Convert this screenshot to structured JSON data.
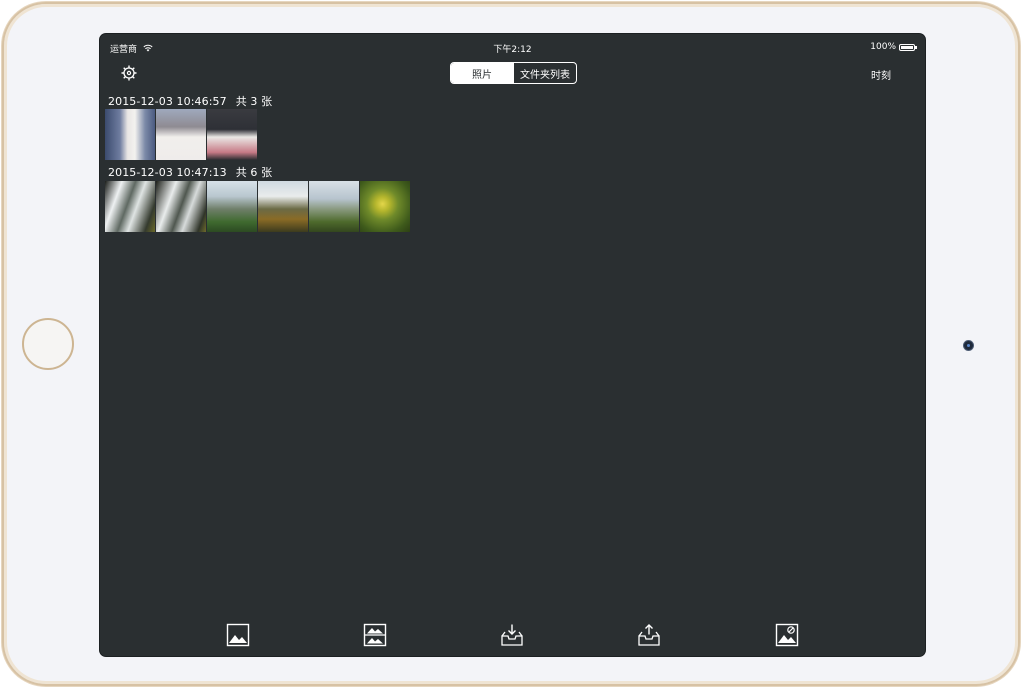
{
  "status_bar": {
    "carrier": "运营商",
    "time": "下午2:12",
    "battery": "100%"
  },
  "nav": {
    "segments": [
      "照片",
      "文件夹列表"
    ],
    "selected_segment": "照片",
    "right_button": "时刻",
    "left_icon": "settings-gear-icon"
  },
  "groups": [
    {
      "timestamp": "2015-12-03 10:46:57",
      "count_label": "共 3 张",
      "thumbnails": [
        "portrait-photo",
        "portrait-photo",
        "portrait-photo"
      ]
    },
    {
      "timestamp": "2015-12-03 10:47:13",
      "count_label": "共 6 张",
      "thumbnails": [
        "waterfall-photo",
        "waterfall-photo",
        "waterfall-photo",
        "waterfall-photo",
        "landscape-photo",
        "leaf-photo"
      ]
    }
  ],
  "toolbar": {
    "icons": [
      "image-icon",
      "image-stack-icon",
      "import-tray-icon",
      "export-tray-icon",
      "image-edit-icon"
    ]
  },
  "colors": {
    "screen_bg": "#2a2f31",
    "text": "#ffffff",
    "frame_gold": "#d7c2a4"
  }
}
